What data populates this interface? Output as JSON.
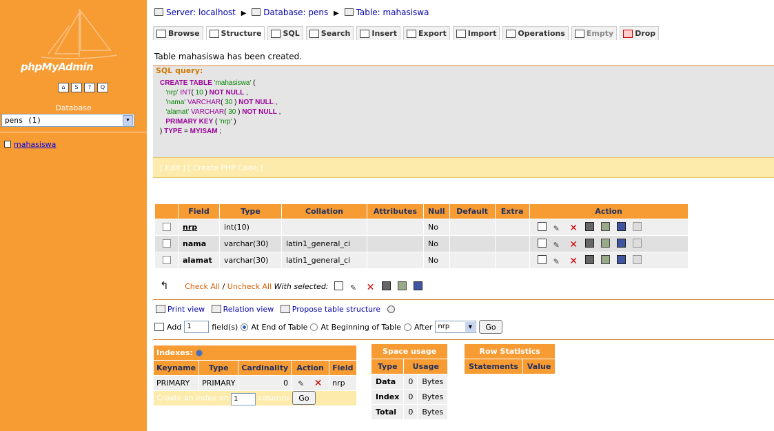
{
  "left": {
    "logo_text": "phpMyAdmin",
    "icons": [
      "home-icon",
      "sql-icon",
      "help-icon",
      "query-window-icon"
    ],
    "database_label": "Database",
    "database_selected": "pens (1)",
    "tables": [
      "mahasiswa"
    ]
  },
  "breadcrumb": {
    "server": "Server: localhost",
    "database": "Database: pens",
    "table": "Table: mahasiswa"
  },
  "tabs": [
    "Browse",
    "Structure",
    "SQL",
    "Search",
    "Insert",
    "Export",
    "Import",
    "Operations",
    "Empty",
    "Drop"
  ],
  "message": "Table mahasiswa has been created.",
  "sql": {
    "legend": "SQL query:",
    "footer": "[ Edit ] [ Create PHP Code ]"
  },
  "structure": {
    "headers": [
      "Field",
      "Type",
      "Collation",
      "Attributes",
      "Null",
      "Default",
      "Extra",
      "Action"
    ],
    "rows": [
      {
        "field": "nrp",
        "type": "int(10)",
        "collation": "",
        "attributes": "",
        "null": "No",
        "default": "",
        "extra": ""
      },
      {
        "field": "nama",
        "type": "varchar(30)",
        "collation": "latin1_general_ci",
        "attributes": "",
        "null": "No",
        "default": "",
        "extra": ""
      },
      {
        "field": "alamat",
        "type": "varchar(30)",
        "collation": "latin1_general_ci",
        "attributes": "",
        "null": "No",
        "default": "",
        "extra": ""
      }
    ],
    "check_all": "Check All",
    "slash": "/",
    "uncheck_all": "Uncheck All",
    "with_selected": "With selected:"
  },
  "links": {
    "print_view": "Print view",
    "relation_view": "Relation view",
    "propose": "Propose table structure"
  },
  "add_field": {
    "label": "Add",
    "count": "1",
    "fields_label": "field(s)",
    "at_end": "At End of Table",
    "at_beginning": "At Beginning of Table",
    "after": "After",
    "after_value": "nrp",
    "go": "Go"
  },
  "indexes": {
    "caption": "Indexes:",
    "headers": [
      "Keyname",
      "Type",
      "Cardinality",
      "Action",
      "Field"
    ],
    "row": {
      "keyname": "PRIMARY",
      "type": "PRIMARY",
      "cardinality": "0",
      "field": "nrp"
    },
    "create_label": "Create an index on",
    "create_count": "1",
    "columns_label": "columns",
    "go": "Go"
  },
  "space_usage": {
    "caption": "Space usage",
    "headers": [
      "Type",
      "Usage"
    ],
    "rows": [
      {
        "type": "Data",
        "value": "0",
        "unit": "Bytes"
      },
      {
        "type": "Index",
        "value": "0",
        "unit": "Bytes"
      },
      {
        "type": "Total",
        "value": "0",
        "unit": "Bytes"
      }
    ]
  },
  "row_stats": {
    "caption": "Row Statistics",
    "headers": [
      "Statements",
      "Value"
    ]
  },
  "colors": {
    "accent": "#F79B33",
    "link": "#0000AA",
    "sql_bg": "#E5E5E5"
  }
}
